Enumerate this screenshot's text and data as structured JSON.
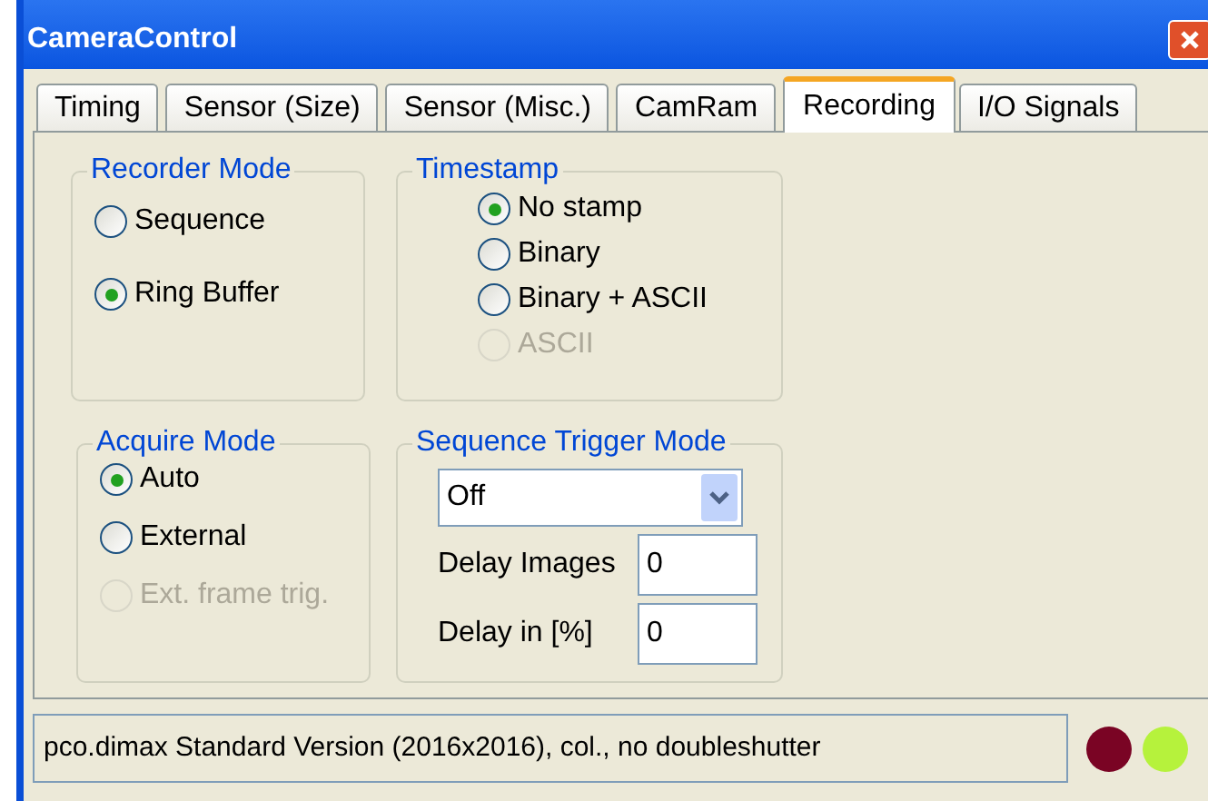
{
  "window": {
    "title": "CameraControl"
  },
  "tabs": [
    {
      "label": "Timing",
      "selected": false
    },
    {
      "label": "Sensor (Size)",
      "selected": false
    },
    {
      "label": "Sensor (Misc.)",
      "selected": false
    },
    {
      "label": "CamRam",
      "selected": false
    },
    {
      "label": "Recording",
      "selected": true
    },
    {
      "label": "I/O Signals",
      "selected": false
    }
  ],
  "recorder_mode": {
    "title": "Recorder Mode",
    "options": [
      {
        "label": "Sequence",
        "selected": false,
        "disabled": false
      },
      {
        "label": "Ring Buffer",
        "selected": true,
        "disabled": false
      }
    ]
  },
  "timestamp": {
    "title": "Timestamp",
    "options": [
      {
        "label": "No stamp",
        "selected": true,
        "disabled": false
      },
      {
        "label": "Binary",
        "selected": false,
        "disabled": false
      },
      {
        "label": "Binary + ASCII",
        "selected": false,
        "disabled": false
      },
      {
        "label": "ASCII",
        "selected": false,
        "disabled": true
      }
    ]
  },
  "acquire_mode": {
    "title": "Acquire Mode",
    "options": [
      {
        "label": "Auto",
        "selected": true,
        "disabled": false
      },
      {
        "label": "External",
        "selected": false,
        "disabled": false
      },
      {
        "label": "Ext. frame trig.",
        "selected": false,
        "disabled": true
      }
    ]
  },
  "sequence_trigger_mode": {
    "title": "Sequence Trigger Mode",
    "dropdown": {
      "value": "Off"
    },
    "fields": [
      {
        "label": "Delay Images",
        "value": "0"
      },
      {
        "label": "Delay in [%]",
        "value": "0"
      }
    ]
  },
  "status_bar": {
    "text": "pco.dimax Standard Version (2016x2016), col., no doubleshutter",
    "indicators": [
      {
        "color": "#7a0424"
      },
      {
        "color": "#b6f23c"
      }
    ]
  }
}
